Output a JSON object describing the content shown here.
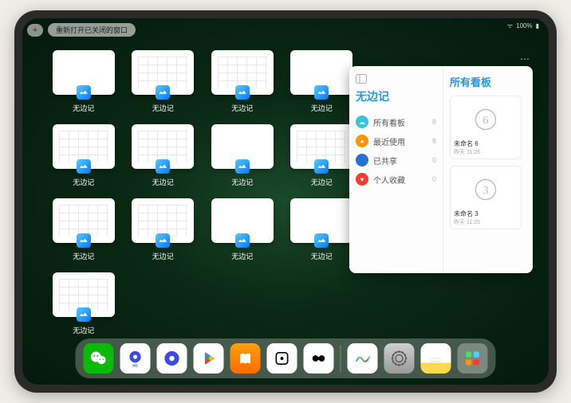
{
  "status": {
    "network": "ᯤ",
    "battery": "100%",
    "battery_icon": "▮"
  },
  "topbar": {
    "plus": "+",
    "reopen_label": "重新打开已关闭的窗口"
  },
  "app_switcher": {
    "app_label": "无边记",
    "tiles": [
      {
        "type": "blank"
      },
      {
        "type": "grid"
      },
      {
        "type": "grid"
      },
      {
        "type": "blank"
      },
      {
        "type": "grid"
      },
      {
        "type": "grid"
      },
      {
        "type": "blank"
      },
      {
        "type": "grid"
      },
      {
        "type": "grid"
      },
      {
        "type": "grid"
      },
      {
        "type": "blank"
      },
      {
        "type": "blank"
      },
      {
        "type": "grid"
      }
    ]
  },
  "panel": {
    "sidebar_icon": "sidebar",
    "left_title": "无边记",
    "right_title": "所有看板",
    "items": [
      {
        "icon_color": "#38c5d9",
        "glyph": "☁",
        "label": "所有看板",
        "count": 8
      },
      {
        "icon_color": "#ff9500",
        "glyph": "●",
        "label": "最近使用",
        "count": 8
      },
      {
        "icon_color": "#2f6fd6",
        "glyph": "👤",
        "label": "已共享",
        "count": 0
      },
      {
        "icon_color": "#ff3b30",
        "glyph": "♥",
        "label": "个人收藏",
        "count": 0
      }
    ],
    "boards": [
      {
        "name": "未命名 6",
        "meta": "昨天 11:26",
        "digit": "6"
      },
      {
        "name": "未命名 3",
        "meta": "昨天 11:25",
        "digit": "3"
      }
    ]
  },
  "dock": {
    "apps": [
      {
        "name": "wechat",
        "bg": "#09bb07"
      },
      {
        "name": "quark-hd",
        "bg": "#ffffff"
      },
      {
        "name": "quark",
        "bg": "#ffffff"
      },
      {
        "name": "play-store",
        "bg": "#ffffff"
      },
      {
        "name": "books",
        "bg": "linear-gradient(#ff9f0a,#ff6a00)"
      },
      {
        "name": "dice",
        "bg": "#ffffff"
      },
      {
        "name": "meitu",
        "bg": "#ffffff"
      }
    ],
    "recent": [
      {
        "name": "freeform",
        "bg": "#ffffff"
      },
      {
        "name": "settings",
        "bg": "linear-gradient(#cfcfcf,#9a9a9a)"
      },
      {
        "name": "notes",
        "bg": "linear-gradient(#fff 65%,#ffd84d 65%)"
      },
      {
        "name": "app-library",
        "bg": "rgba(255,255,255,0.3)"
      }
    ]
  }
}
